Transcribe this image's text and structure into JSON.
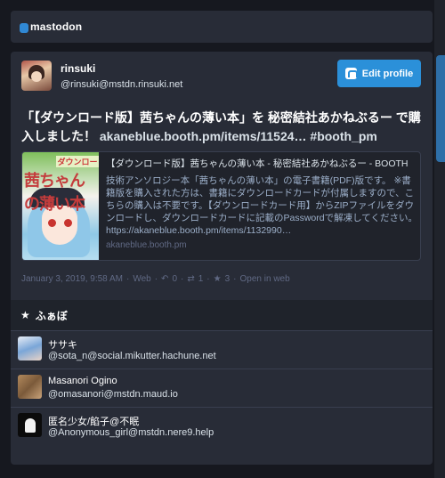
{
  "topbar": {
    "logo_text": "mastodon"
  },
  "profile": {
    "display_name": "rinsuki",
    "acct": "@rinsuki@mstdn.rinsuki.net",
    "edit_button": "Edit profile"
  },
  "status": {
    "content": "「【ダウンロード版】茜ちゃんの薄い本」を 秘密結社あかねぶるー で購入しました！ ",
    "link": "akaneblue.booth.pm/items/11524…",
    "hashtag": " #booth_pm",
    "card": {
      "thumb_title": "茜ちゃんの薄い本",
      "thumb_tag": "ダウンロー",
      "title": "【ダウンロード版】茜ちゃんの薄い本 - 秘密結社あかねぶるー - BOOTH",
      "description": "技術アンソロジー本「茜ちゃんの薄い本」の電子書籍(PDF)版です。 ※書籍版を購入された方は、書籍にダウンロードカードが付属しますので、こちらの購入は不要です。【ダウンロードカード用】からZIPファイルをダウンロードし、ダウンロードカードに記載のPasswordで解凍してください。 https://akaneblue.booth.pm/items/1132990…",
      "host": "akaneblue.booth.pm"
    },
    "meta": {
      "timestamp": "January 3, 2019, 9:58 AM",
      "dot1": "·",
      "app": "Web",
      "dot2": "·",
      "reply_count": "0",
      "dot3": "·",
      "boost_count": "1",
      "dot4": "·",
      "fav_count": "3",
      "dot5": "·",
      "open_in_web": "Open in web"
    }
  },
  "favourites": {
    "header": "ふぁぼ",
    "accounts": [
      {
        "name": "ササキ",
        "acct": "@sota_n@social.mikutter.hachune.net"
      },
      {
        "name": "Masanori Ogino",
        "acct": "@omasanori@mstdn.maud.io"
      },
      {
        "name": "匿名少女/餡子@不眠",
        "acct": "@Anonymous_girl@mstdn.nere9.help"
      }
    ]
  },
  "icons": {
    "logo": "mastodon-logo-icon",
    "edit": "mastodon-icon",
    "reply": "reply-icon",
    "boost": "retweet-icon",
    "fav": "star-icon"
  }
}
